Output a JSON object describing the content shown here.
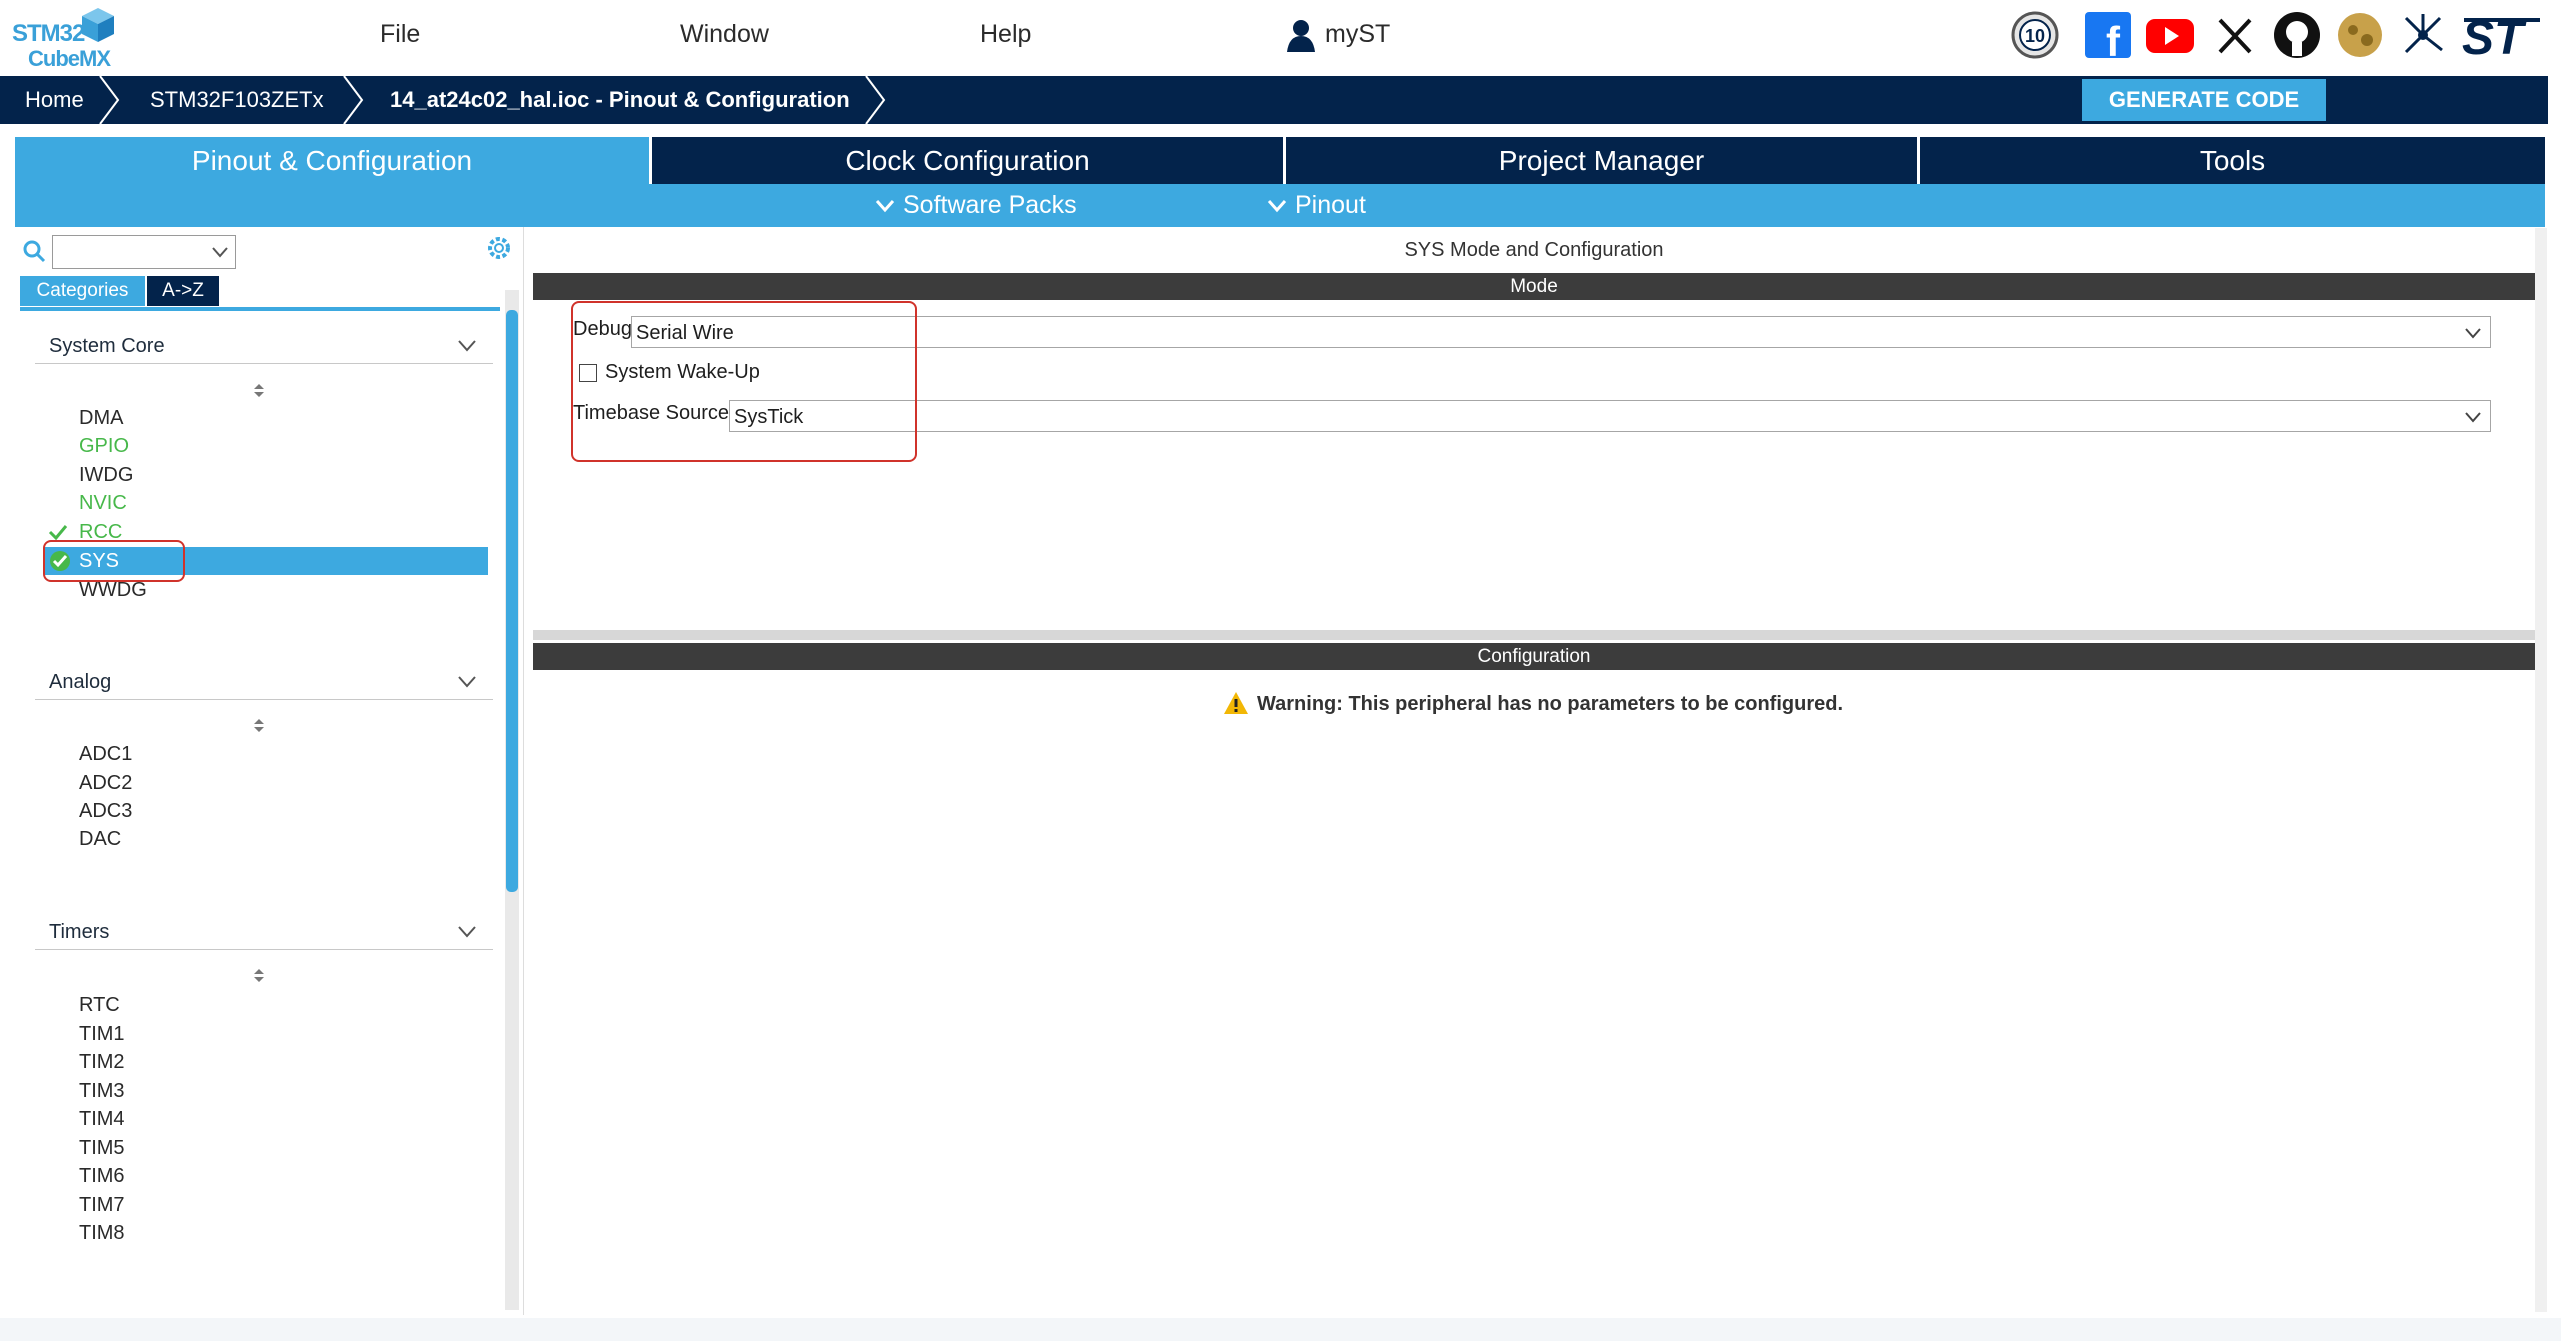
{
  "app": {
    "logo_top": "STM32",
    "logo_bottom": "CubeMX"
  },
  "menu": {
    "file": "File",
    "window": "Window",
    "help": "Help",
    "myst": "myST"
  },
  "social_icons": [
    "badge-10-icon",
    "facebook-icon",
    "youtube-icon",
    "x-icon",
    "github-icon",
    "community-icon",
    "network-icon",
    "st-logo-icon"
  ],
  "breadcrumb": {
    "home": "Home",
    "device": "STM32F103ZETx",
    "project": "14_at24c02_hal.ioc - Pinout & Configuration"
  },
  "generate_code": "GENERATE CODE",
  "tabs": [
    "Pinout & Configuration",
    "Clock Configuration",
    "Project Manager",
    "Tools"
  ],
  "subtabs": {
    "software_packs": "Software Packs",
    "pinout": "Pinout"
  },
  "left": {
    "search_value": "",
    "cat_tabs": {
      "categories": "Categories",
      "az": "A->Z"
    },
    "sections": [
      {
        "title": "System Core",
        "items": [
          "DMA",
          "GPIO",
          "IWDG",
          "NVIC",
          "RCC",
          "SYS",
          "WWDG"
        ]
      },
      {
        "title": "Analog",
        "items": [
          "ADC1",
          "ADC2",
          "ADC3",
          "DAC"
        ]
      },
      {
        "title": "Timers",
        "items": [
          "RTC",
          "TIM1",
          "TIM2",
          "TIM3",
          "TIM4",
          "TIM5",
          "TIM6",
          "TIM7",
          "TIM8"
        ]
      }
    ]
  },
  "right": {
    "panel_title": "SYS Mode and Configuration",
    "mode_header": "Mode",
    "debug_label": "Debug",
    "debug_value": "Serial Wire",
    "wakeup_label": "System Wake-Up",
    "timebase_label": "Timebase Source",
    "timebase_value": "SysTick",
    "config_header": "Configuration",
    "warning": "Warning: This peripheral has no parameters to be configured."
  },
  "colors": {
    "navy": "#03234b",
    "accent": "#3da9e0",
    "green": "#47b84a",
    "highlight_red": "#d0332b"
  }
}
